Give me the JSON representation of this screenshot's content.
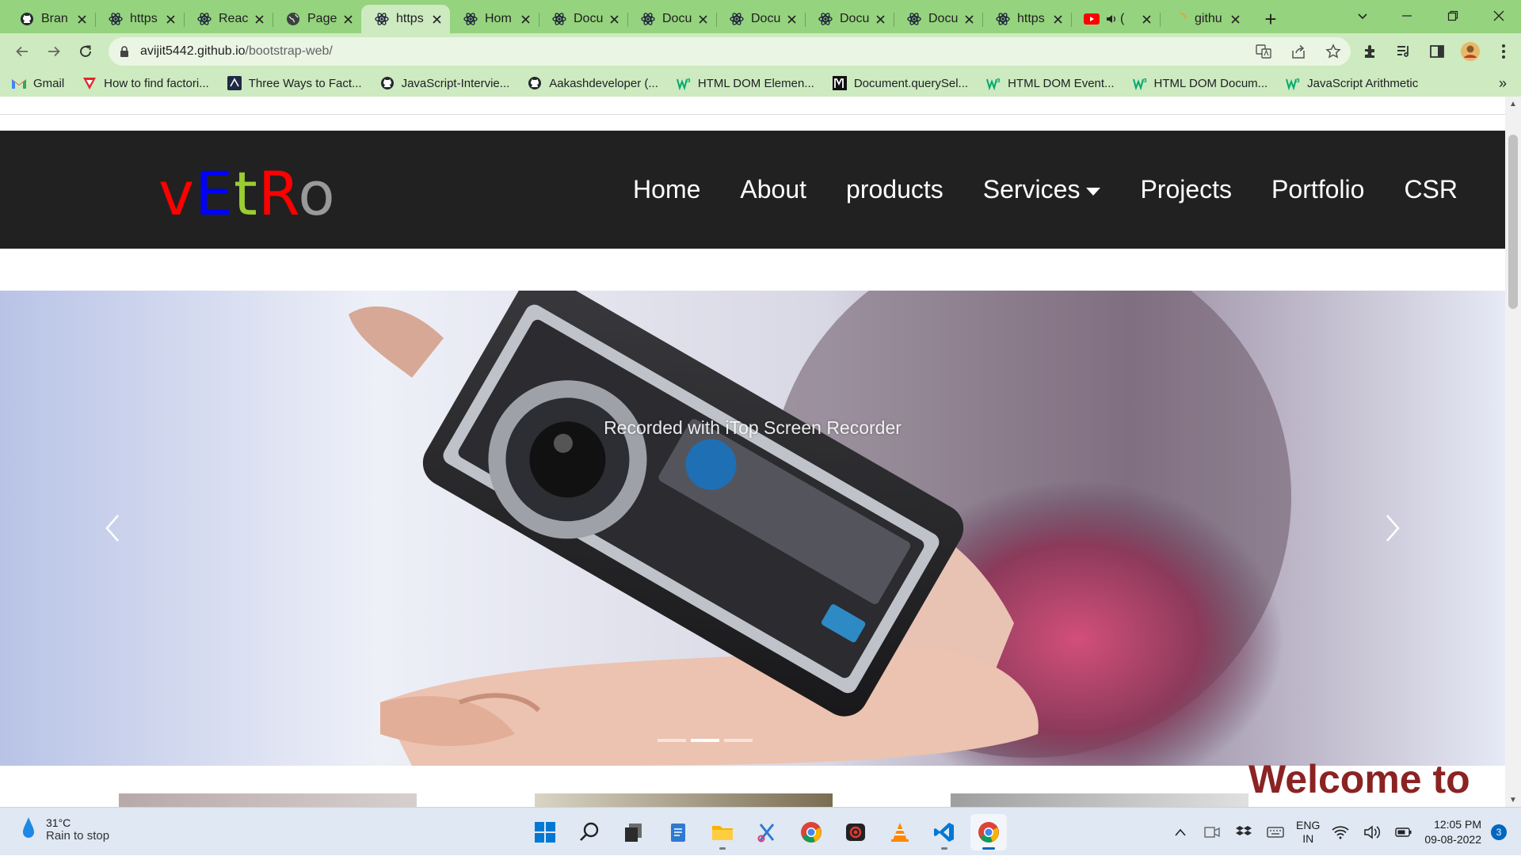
{
  "browser": {
    "tabs": [
      {
        "title": "Bran",
        "icon": "github-icon"
      },
      {
        "title": "https",
        "icon": "react-icon"
      },
      {
        "title": "Reac",
        "icon": "react-icon"
      },
      {
        "title": "Page",
        "icon": "globe-icon"
      },
      {
        "title": "https",
        "icon": "react-icon",
        "active": true
      },
      {
        "title": "Hom",
        "icon": "react-icon"
      },
      {
        "title": "Docu",
        "icon": "react-icon"
      },
      {
        "title": "Docu",
        "icon": "react-icon"
      },
      {
        "title": "Docu",
        "icon": "react-icon"
      },
      {
        "title": "Docu",
        "icon": "react-icon"
      },
      {
        "title": "Docu",
        "icon": "react-icon"
      },
      {
        "title": "https",
        "icon": "react-icon"
      },
      {
        "title": "(",
        "icon": "youtube-icon"
      },
      {
        "title": "githu",
        "icon": "loading-icon"
      }
    ],
    "new_tab": "+",
    "url": {
      "host": "avijit5442.github.io",
      "path": "/bootstrap-web/"
    },
    "bookmarks": [
      {
        "label": "Gmail",
        "icon": "gmail-icon"
      },
      {
        "label": "How to find factori...",
        "icon": "v-icon"
      },
      {
        "label": "Three Ways to Fact...",
        "icon": "codeacademy-icon"
      },
      {
        "label": "JavaScript-Intervie...",
        "icon": "github-icon"
      },
      {
        "label": "Aakashdeveloper (...",
        "icon": "github-icon"
      },
      {
        "label": "HTML DOM Elemen...",
        "icon": "w3schools-icon"
      },
      {
        "label": "Document.querySel...",
        "icon": "mdn-icon"
      },
      {
        "label": "HTML DOM Event...",
        "icon": "w3schools-icon"
      },
      {
        "label": "HTML DOM Docum...",
        "icon": "w3schools-icon"
      },
      {
        "label": "JavaScript Arithmetic",
        "icon": "w3schools-icon"
      }
    ],
    "bookmarks_more": "»"
  },
  "site": {
    "logo": [
      "v",
      "E",
      "t",
      "R",
      "o"
    ],
    "logo_colors": [
      "#ff0000",
      "#0000ff",
      "#9acd32",
      "#ff0000",
      "#999999"
    ],
    "nav": [
      "Home",
      "About",
      "products",
      "Services",
      "Projects",
      "Portfolio",
      "CSR"
    ],
    "carousel": {
      "watermark": "Recorded with iTop Screen Recorder",
      "active_slide": 1,
      "slide_count": 3
    },
    "welcome": "Welcome to"
  },
  "taskbar": {
    "weather_temp": "31°C",
    "weather_desc": "Rain to stop",
    "lang_line1": "ENG",
    "lang_line2": "IN",
    "time": "12:05 PM",
    "date": "09-08-2022",
    "notifications": "3"
  }
}
